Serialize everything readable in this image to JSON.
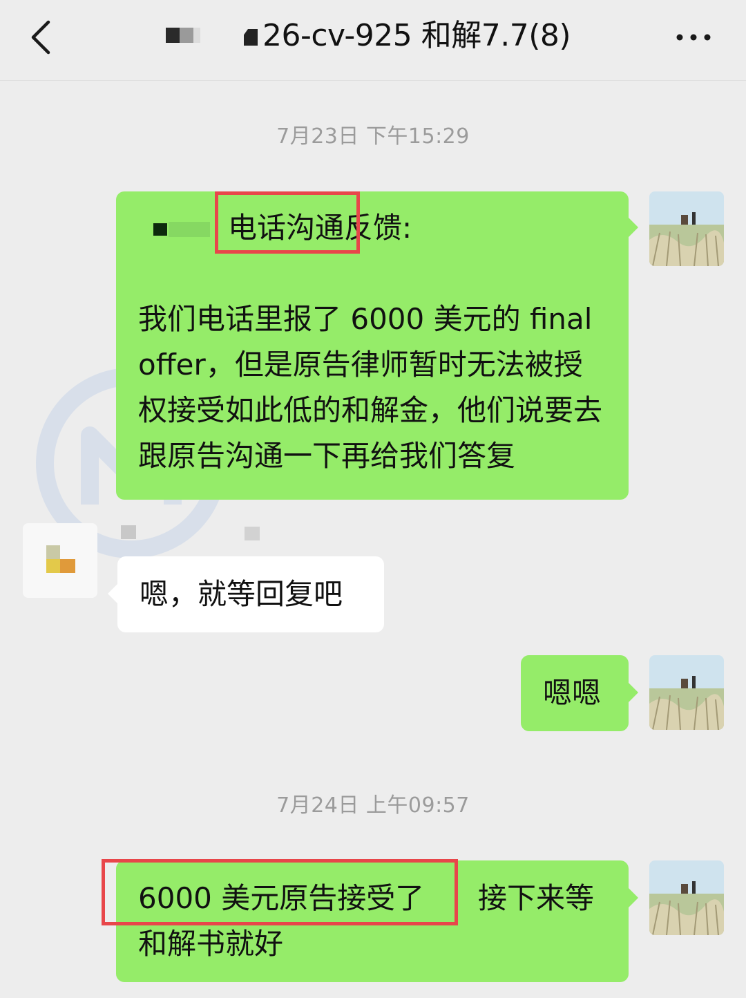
{
  "header": {
    "title": "26-cv-925 和解7.7(8)"
  },
  "messages": [
    {
      "timestamp": "7月23日 下午15:29"
    },
    {
      "side": "right",
      "highlight": "电话沟通",
      "heading_rest": "反馈:",
      "body": "我们电话里报了 6000 美元的 final offer，但是原告律师暂时无法被授权接受如此低的和解金，他们说要去跟原告沟通一下再给我们答复"
    },
    {
      "side": "left",
      "text": "嗯，就等回复吧"
    },
    {
      "side": "right",
      "text": "嗯嗯"
    },
    {
      "timestamp": "7月24日 上午09:57"
    },
    {
      "side": "right",
      "highlight": "6000 美元原告接受了",
      "rest": "接下来等",
      "line2": "和解书就好"
    }
  ],
  "colors": {
    "background": "#ededed",
    "bubble_self": "#95ec69",
    "bubble_other": "#ffffff",
    "highlight_box": "#e8464a",
    "timestamp": "#9b9b9b"
  },
  "icons": {
    "back": "chevron-left-icon",
    "more": "more-dots-icon"
  }
}
